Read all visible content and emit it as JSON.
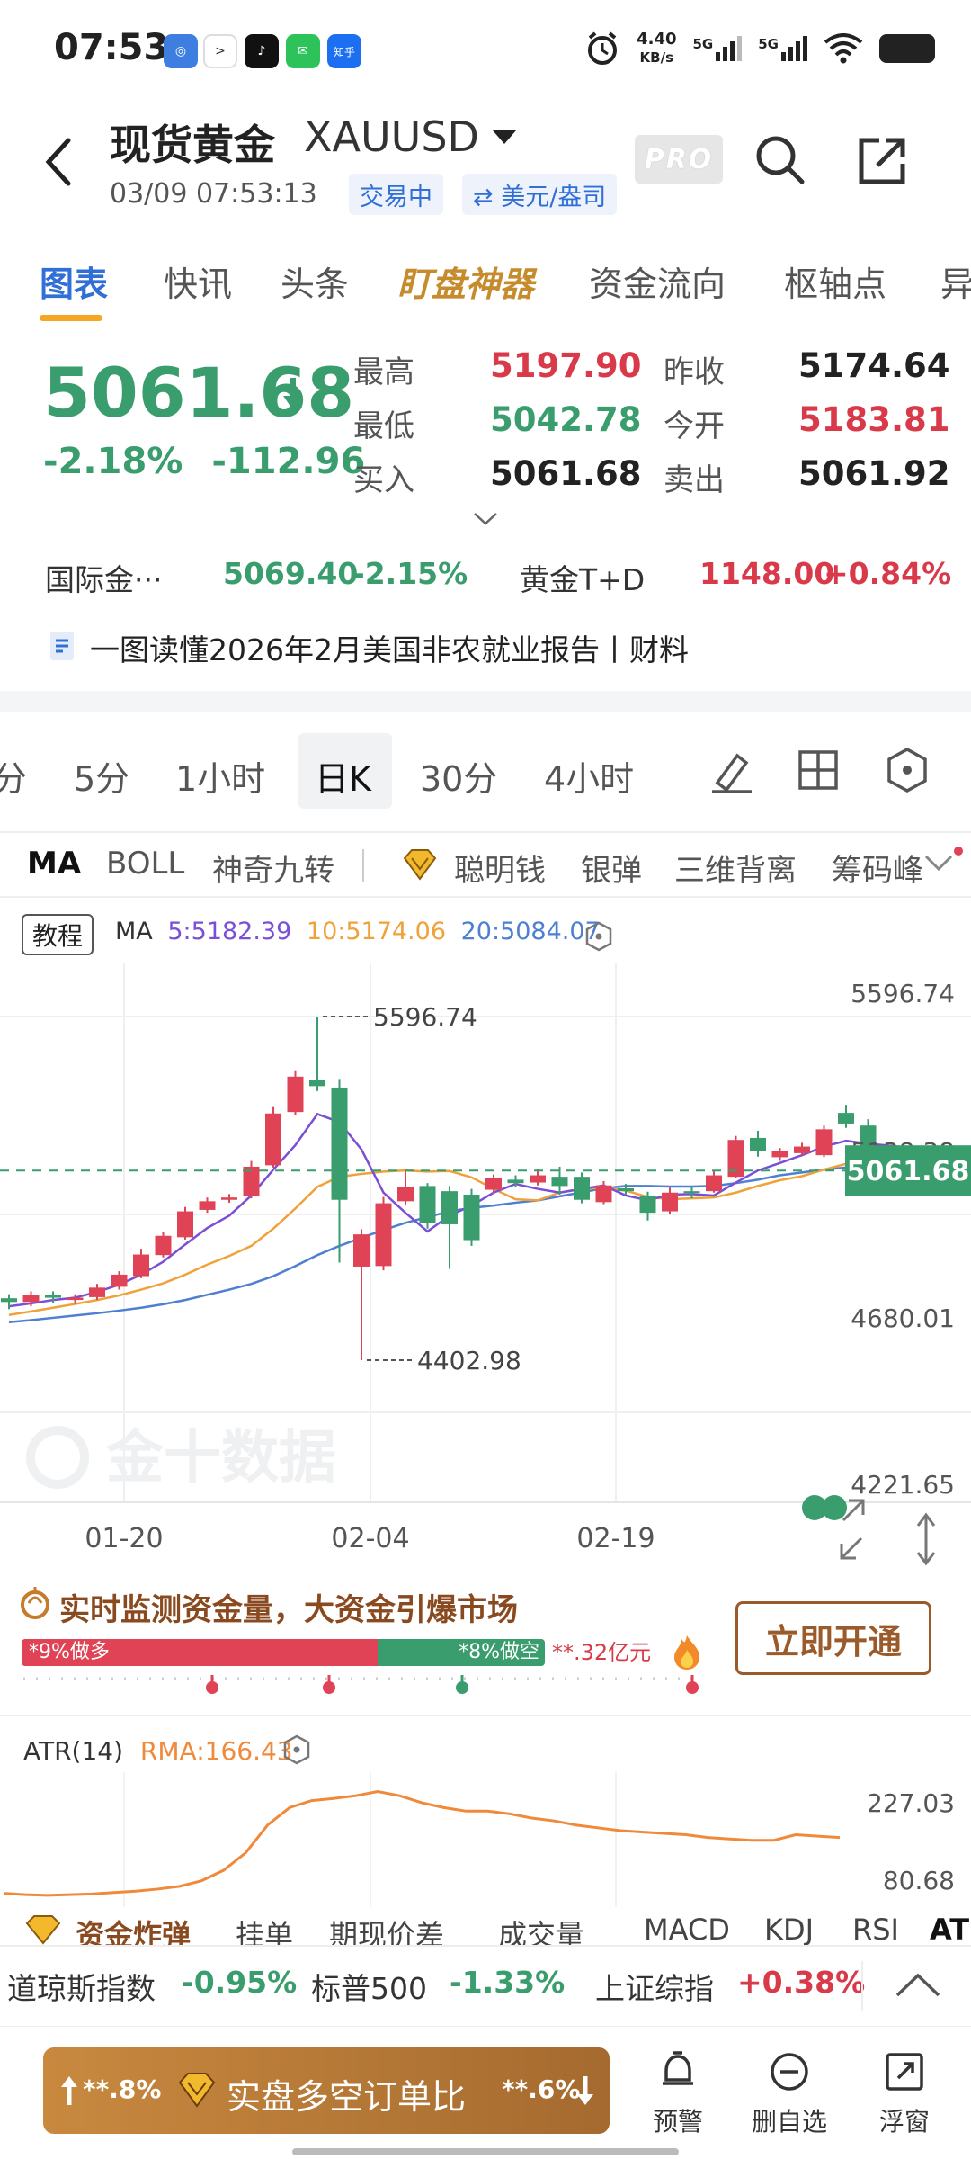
{
  "status": {
    "time": "07:53",
    "net_speed": "4.40",
    "net_unit": "KB/s",
    "sig1": "5G",
    "sig2": "5G",
    "zhihu": "知乎"
  },
  "header": {
    "title": "现货黄金",
    "symbol": "XAUUSD",
    "timestamp": "03/09 07:53:13",
    "trading_badge": "交易中",
    "unit_badge": "⇄ 美元/盎司",
    "pro": "PRO"
  },
  "tabs": [
    "图表",
    "快讯",
    "头条",
    "盯盘神器",
    "资金流向",
    "枢轴点",
    "异"
  ],
  "quote": {
    "price": "5061.68",
    "change_pct": "-2.18%",
    "change_abs": "-112.96",
    "high_label": "最高",
    "high": "5197.90",
    "low_label": "最低",
    "low": "5042.78",
    "bid_label": "买入",
    "bid": "5061.68",
    "prev_close_label": "昨收",
    "prev_close": "5174.64",
    "open_label": "今开",
    "open": "5183.81",
    "ask_label": "卖出",
    "ask": "5061.92"
  },
  "related": {
    "intl_name": "国际金···",
    "intl_price": "5069.40",
    "intl_pct": "-2.15%",
    "td_name": "黄金T+D",
    "td_price": "1148.00",
    "td_pct": "+0.84%"
  },
  "news": {
    "text": "一图读懂2026年2月美国非农就业报告丨财料"
  },
  "periods": [
    "分",
    "5分",
    "1小时",
    "日K",
    "30分",
    "4小时"
  ],
  "indicators": [
    "MA",
    "BOLL",
    "神奇九转",
    "聪明钱",
    "银弹",
    "三维背离",
    "筹码峰"
  ],
  "chart": {
    "tutorial": "教程",
    "ma_label": "MA",
    "ma5": "5:5182.39",
    "ma10": "10:5174.06",
    "ma20": "20:5084.07",
    "y_labels": [
      "5596.74",
      "5138.38",
      "4680.01",
      "4221.65"
    ],
    "current_price_tag": "5061.68",
    "max_label": "5596.74",
    "min_label": "4402.98",
    "x_labels": [
      "01-20",
      "02-04",
      "02-19"
    ],
    "watermark": "金十数据",
    "colors": {
      "up": "#e04356",
      "down": "#3a9d6e",
      "ma5": "#7a4fd6",
      "ma10": "#f0a23a",
      "ma20": "#4e7fd0"
    }
  },
  "chart_data": {
    "type": "candlestick",
    "ylim": [
      4221.65,
      5596.74
    ],
    "x_labels": [
      "01-20",
      "02-04",
      "02-19"
    ],
    "candles": [
      {
        "o": 4618,
        "c": 4605,
        "h": 4632,
        "l": 4580
      },
      {
        "o": 4605,
        "c": 4630,
        "h": 4642,
        "l": 4590
      },
      {
        "o": 4630,
        "c": 4620,
        "h": 4642,
        "l": 4600
      },
      {
        "o": 4612,
        "c": 4620,
        "h": 4632,
        "l": 4598
      },
      {
        "o": 4622,
        "c": 4655,
        "h": 4668,
        "l": 4612
      },
      {
        "o": 4658,
        "c": 4700,
        "h": 4712,
        "l": 4648
      },
      {
        "o": 4695,
        "c": 4770,
        "h": 4790,
        "l": 4688
      },
      {
        "o": 4768,
        "c": 4835,
        "h": 4850,
        "l": 4760
      },
      {
        "o": 4830,
        "c": 4920,
        "h": 4935,
        "l": 4822
      },
      {
        "o": 4925,
        "c": 4955,
        "h": 4968,
        "l": 4915
      },
      {
        "o": 4960,
        "c": 4968,
        "h": 4980,
        "l": 4950
      },
      {
        "o": 4972,
        "c": 5075,
        "h": 5095,
        "l": 4965
      },
      {
        "o": 5080,
        "c": 5260,
        "h": 5282,
        "l": 5072
      },
      {
        "o": 5265,
        "c": 5388,
        "h": 5410,
        "l": 5255
      },
      {
        "o": 5378,
        "c": 5355,
        "h": 5596.74,
        "l": 5338
      },
      {
        "o": 5350,
        "c": 4960,
        "h": 5380,
        "l": 4742
      },
      {
        "o": 4728,
        "c": 4840,
        "h": 4858,
        "l": 4402.98
      },
      {
        "o": 4730,
        "c": 4948,
        "h": 4970,
        "l": 4715
      },
      {
        "o": 4955,
        "c": 5005,
        "h": 5058,
        "l": 4940
      },
      {
        "o": 5008,
        "c": 4880,
        "h": 5018,
        "l": 4860
      },
      {
        "o": 4990,
        "c": 4875,
        "h": 5008,
        "l": 4720
      },
      {
        "o": 4978,
        "c": 4820,
        "h": 4998,
        "l": 4800
      },
      {
        "o": 4995,
        "c": 5035,
        "h": 5048,
        "l": 4982
      },
      {
        "o": 5030,
        "c": 5018,
        "h": 5045,
        "l": 5005
      },
      {
        "o": 5020,
        "c": 5045,
        "h": 5068,
        "l": 5010
      },
      {
        "o": 5040,
        "c": 5008,
        "h": 5075,
        "l": 4978
      },
      {
        "o": 5040,
        "c": 4960,
        "h": 5055,
        "l": 4948
      },
      {
        "o": 4952,
        "c": 5010,
        "h": 5025,
        "l": 4945
      },
      {
        "o": 5000,
        "c": 4990,
        "h": 5015,
        "l": 4978
      },
      {
        "o": 4975,
        "c": 4915,
        "h": 4988,
        "l": 4888
      },
      {
        "o": 4920,
        "c": 4985,
        "h": 5002,
        "l": 4912
      },
      {
        "o": 4990,
        "c": 4985,
        "h": 5008,
        "l": 4965
      },
      {
        "o": 4990,
        "c": 5045,
        "h": 5062,
        "l": 4985
      },
      {
        "o": 5040,
        "c": 5168,
        "h": 5182,
        "l": 5035
      },
      {
        "o": 5175,
        "c": 5130,
        "h": 5200,
        "l": 5110
      },
      {
        "o": 5108,
        "c": 5128,
        "h": 5140,
        "l": 5095
      },
      {
        "o": 5122,
        "c": 5145,
        "h": 5158,
        "l": 5115
      },
      {
        "o": 5115,
        "c": 5205,
        "h": 5218,
        "l": 5108
      },
      {
        "o": 5262,
        "c": 5225,
        "h": 5290,
        "l": 5210
      },
      {
        "o": 5218,
        "c": 5088,
        "h": 5240,
        "l": 5012
      },
      {
        "o": 5088,
        "c": 5120,
        "h": 5138,
        "l": 5078
      },
      {
        "o": 5118,
        "c": 5068,
        "h": 5130,
        "l": 5050
      }
    ],
    "ma5": [
      4590,
      4600,
      4612,
      4620,
      4640,
      4665,
      4700,
      4745,
      4805,
      4862,
      4905,
      4975,
      5065,
      5150,
      5258,
      5230,
      5135,
      4985,
      4915,
      4850,
      4905,
      4940,
      4985,
      5015,
      4998,
      4985,
      4998,
      5010,
      4975,
      4958,
      4978,
      4980,
      4975,
      5020,
      5062,
      5088,
      5115,
      5145,
      5165,
      5155,
      5148,
      5138
    ],
    "ma10": [
      4560,
      4572,
      4585,
      4598,
      4612,
      4628,
      4648,
      4670,
      4700,
      4735,
      4765,
      4800,
      4860,
      4930,
      5005,
      5040,
      5050,
      5058,
      5062,
      5058,
      5060,
      5038,
      4998,
      4962,
      4958,
      4985,
      4998,
      5002,
      4992,
      4970,
      4962,
      4965,
      4968,
      4985,
      5008,
      5028,
      5042,
      5065,
      5085,
      5095,
      5110,
      5112
    ],
    "ma20": [
      4535,
      4542,
      4550,
      4558,
      4566,
      4575,
      4585,
      4597,
      4612,
      4630,
      4648,
      4668,
      4695,
      4730,
      4768,
      4800,
      4828,
      4855,
      4880,
      4900,
      4920,
      4932,
      4940,
      4950,
      4958,
      4972,
      4986,
      5000,
      5008,
      5008,
      5006,
      5006,
      5008,
      5018,
      5030,
      5045,
      5055,
      5065,
      5072,
      5075,
      5080,
      5084
    ]
  },
  "fund_monitor": {
    "title": "实时监测资金量，大资金引爆市场",
    "long_label": "*9%做多",
    "short_label": "*8%做空",
    "amount": "**.32亿元",
    "button": "立即开通"
  },
  "atr": {
    "label": "ATR(14)",
    "rma": "RMA:166.43",
    "y_labels": [
      "227.03",
      "80.68"
    ],
    "values": [
      82,
      80,
      79,
      80,
      81,
      83,
      85,
      88,
      92,
      100,
      115,
      140,
      180,
      205,
      215,
      218,
      222,
      228,
      222,
      212,
      205,
      200,
      200,
      196,
      190,
      186,
      180,
      176,
      172,
      170,
      168,
      166,
      162,
      160,
      158,
      158,
      166,
      164,
      162
    ]
  },
  "bottom_tabs": [
    "资金炸弹",
    "挂单",
    "期现价差",
    "成交量",
    "MACD",
    "KDJ",
    "RSI",
    "AT"
  ],
  "ticker": {
    "dji_name": "道琼斯指数",
    "dji_pct": "-0.95%",
    "sp_name": "标普500",
    "sp_pct": "-1.33%",
    "sh_name": "上证综指",
    "sh_pct": "+0.38%"
  },
  "bottom_nav": {
    "long_pct": "**.8%",
    "order_label": "实盘多空订单比",
    "short_pct": "**.6%",
    "alert": "预警",
    "delete_fav": "删自选",
    "float": "浮窗"
  }
}
